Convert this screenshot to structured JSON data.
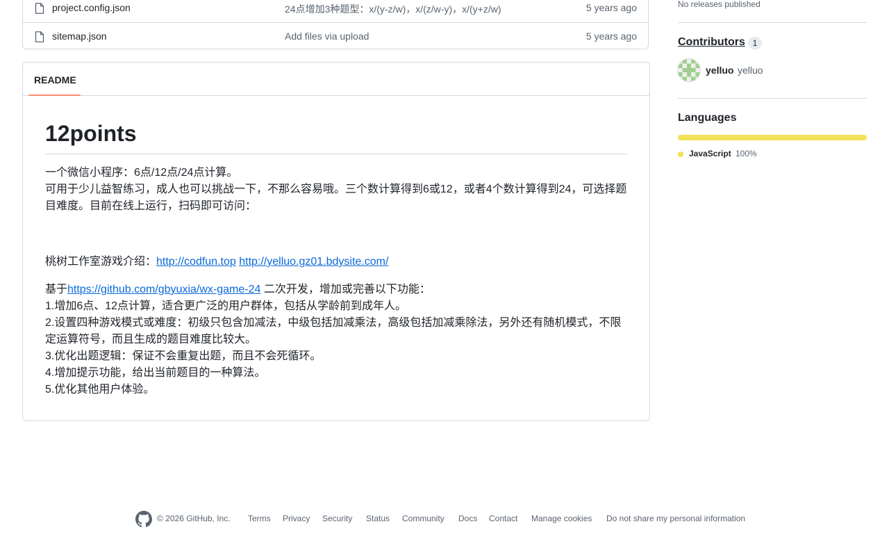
{
  "files": [
    {
      "name": "project.config.json",
      "message": "24点增加3种题型：x/(y-z/w)，x/(z/w-y)，x/(y+z/w)",
      "age": "5 years ago",
      "icon": "file-icon"
    },
    {
      "name": "sitemap.json",
      "message": "Add files via upload",
      "age": "5 years ago",
      "icon": "file-icon"
    }
  ],
  "readme": {
    "tab": "README",
    "title": "12points",
    "line1": "一个微信小程序：6点/12点/24点计算。",
    "line2": "可用于少儿益智练习，成人也可以挑战一下，不那么容易哦。三个数计算得到6或12，或者4个数计算得到24，可选择题目难度。目前在线上运行，扫码即可访问：",
    "intro_prefix": "桃树工作室游戏介绍：",
    "link1": "http://codfun.top",
    "link2": "http://yelluo.gz01.bdysite.com/",
    "based_prefix": "基于",
    "based_link": "https://github.com/gbyuxia/wx-game-24",
    "based_suffix": " 二次开发，增加或完善以下功能：",
    "features": [
      "1.增加6点、12点计算，适合更广泛的用户群体，包括从学龄前到成年人。",
      "2.设置四种游戏模式或难度：初级只包含加减法，中级包括加减乘法，高级包括加减乘除法，另外还有随机模式，不限定运算符号，而且生成的题目难度比较大。",
      "3.优化出题逻辑：保证不会重复出题，而且不会死循环。",
      "4.增加提示功能，给出当前题目的一种算法。",
      "5.优化其他用户体验。"
    ]
  },
  "sidebar": {
    "releases_note": "No releases published",
    "contributors_heading": "Contributors",
    "contributors_count": "1",
    "contributor_login": "yelluo",
    "contributor_name": "yelluo",
    "languages_heading": "Languages",
    "language": {
      "name": "JavaScript",
      "percent": "100%",
      "share": 1.0,
      "color": "#f1e05a"
    }
  },
  "footer": {
    "copyright": "© 2026 GitHub, Inc.",
    "links": [
      "Terms",
      "Privacy",
      "Security",
      "Status",
      "Community",
      "Docs",
      "Contact",
      "Manage cookies",
      "Do not share my personal information"
    ]
  },
  "colors": {
    "link": "#0969da",
    "accent_tab": "#fd8c73",
    "avatar_green": "#9fcf8b"
  }
}
